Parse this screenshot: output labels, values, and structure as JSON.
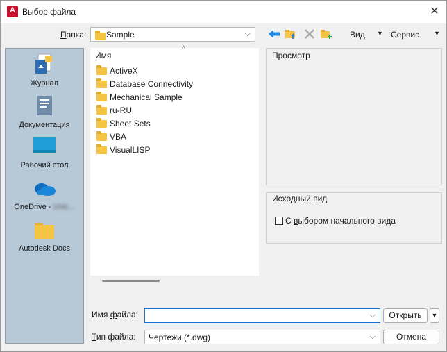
{
  "window": {
    "title": "Выбор файла",
    "close_glyph": "✕"
  },
  "folder_bar": {
    "label_underlined": "П",
    "label_rest": "апка:",
    "current_folder": "Sample"
  },
  "toolbar": {
    "view_label": "Вид",
    "tools_label": "Сервис",
    "icons": [
      "back-arrow-icon",
      "up-folder-icon",
      "delete-icon",
      "new-folder-icon"
    ]
  },
  "places": [
    {
      "label": "Журнал",
      "icon": "history-icon"
    },
    {
      "label": "Документация",
      "icon": "documents-icon"
    },
    {
      "label": "Рабочий стол",
      "icon": "desktop-icon"
    },
    {
      "label": "OneDrive - ",
      "label_blurred": "Unic...",
      "icon": "onedrive-icon"
    },
    {
      "label": "Autodesk Docs",
      "icon": "folder-icon"
    }
  ],
  "file_list": {
    "column_header": "Имя",
    "items": [
      "ActiveX",
      "Database Connectivity",
      "Mechanical Sample",
      "ru-RU",
      "Sheet Sets",
      "VBA",
      "VisualLISP"
    ]
  },
  "preview": {
    "title": "Просмотр"
  },
  "initial_view": {
    "title": "Исходный вид",
    "checkbox_pre": "С ",
    "checkbox_underlined": "в",
    "checkbox_post": "ыбором начального вида",
    "checked": false
  },
  "bottom": {
    "filename_label_pre": "Имя ",
    "filename_label_underlined": "ф",
    "filename_label_post": "айла:",
    "filename_value": "",
    "filetype_label_underlined": "Т",
    "filetype_label_post": "ип файла:",
    "filetype_value": "Чертежи (*.dwg)",
    "open_pre": "От",
    "open_underlined": "к",
    "open_post": "рыть",
    "cancel_label": "Отмена"
  },
  "colors": {
    "places_bg": "#b7c8d7",
    "folder": "#f6c443",
    "accent_blue": "#1e88e5"
  }
}
